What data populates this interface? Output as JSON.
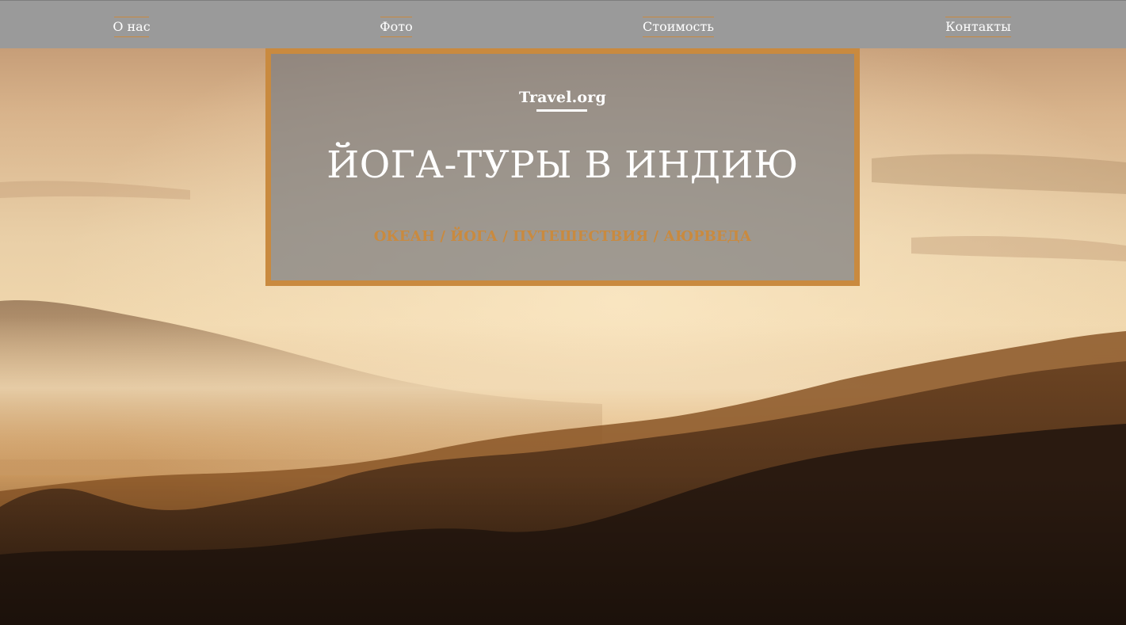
{
  "nav": {
    "items": [
      {
        "label": "О нас"
      },
      {
        "label": "Фото"
      },
      {
        "label": "Стоимость"
      },
      {
        "label": "Контакты"
      }
    ]
  },
  "hero": {
    "brand": "Travel.org",
    "headline": "ЙОГА-ТУРЫ В ИНДИЮ",
    "tagline": "ОКЕАН / ЙОГА / ПУТЕШЕСТВИЯ / АЮРВЕДА"
  },
  "colors": {
    "accent": "#c98a3f",
    "nav_background": "#9a9a9a",
    "hero_overlay": "#7d7d80",
    "text": "#ffffff"
  }
}
